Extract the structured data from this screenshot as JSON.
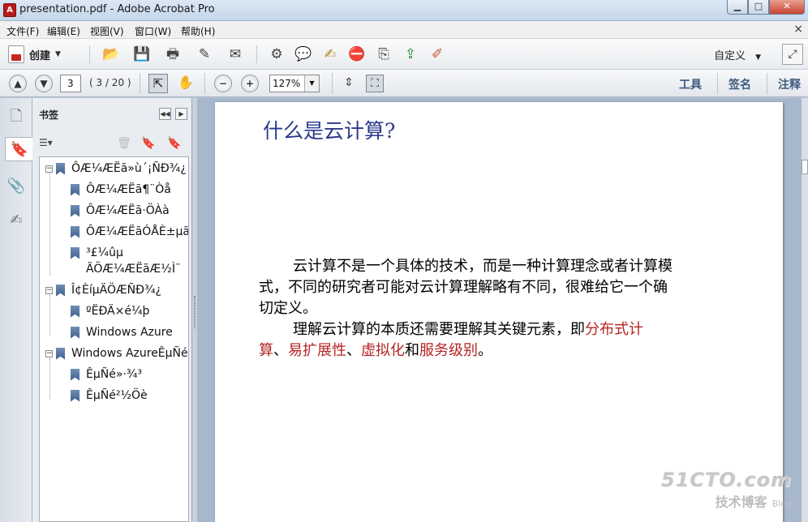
{
  "window": {
    "title": "presentation.pdf - Adobe Acrobat Pro",
    "minimize": "▁",
    "maximize": "□",
    "close": "✕"
  },
  "menu": {
    "items": [
      "文件(F)",
      "编辑(E)",
      "视图(V)",
      "窗口(W)",
      "帮助(H)"
    ],
    "close_doc": "×"
  },
  "toolbar": {
    "create_label": "创建",
    "customize_label": "自定义"
  },
  "navigation": {
    "page_number": "3",
    "page_count": "( 3 / 20 )",
    "zoom": "127%"
  },
  "panels": {
    "tools": "工具",
    "sign": "签名",
    "comment": "注释"
  },
  "bookmarks": {
    "header": "书签",
    "items": [
      {
        "label": "ÔÆ¼ÆËã»ù´¡ÑÐ¾¿",
        "level": 0,
        "toggle": "⊟"
      },
      {
        "label": "ÔÆ¼ÆËã¶¨Òå",
        "level": 1
      },
      {
        "label": "ÔÆ¼ÆËã·ÖÀà",
        "level": 1
      },
      {
        "label": "ÔÆ¼ÆËãÓÅÈ±µã",
        "level": 1
      },
      {
        "label": "³£¼ûµ",
        "level": 1
      },
      {
        "label": "ÄÖÆ¼ÆËãÆ½Ì¨",
        "level": 1,
        "continuation": true
      },
      {
        "label": "Î¢ÈíµÄÖÆÑÐ¾¿",
        "level": 0,
        "toggle": "⊟"
      },
      {
        "label": "ºËÐÄ×é¼þ",
        "level": 1
      },
      {
        "label": "Windows Azure",
        "level": 1
      },
      {
        "label": "Windows AzureÊµÑé",
        "level": 0,
        "toggle": "⊟"
      },
      {
        "label": "ÊµÑé»·¾³",
        "level": 1
      },
      {
        "label": "ÊµÑé²½Öè",
        "level": 1
      }
    ]
  },
  "document": {
    "heading": "什么是云计算?",
    "paragraph1": "云计算不是一个具体的技术，而是一种计算理念或者计算模",
    "paragraph1_line2": "式，不同的研究者可能对云计算理解略有不同，很难给它一个确",
    "paragraph1_line3": "切定义。",
    "paragraph2_start": "理解云计算的本质还需要理解其关键元素，即",
    "term1": "分布式计",
    "term1_cont": "算",
    "sep1": "、",
    "term2": "易扩展性",
    "sep2": "、",
    "term3": "虚拟化",
    "sep3": "和",
    "term4": "服务级别",
    "end": "。",
    "accent_color": "#b42424"
  },
  "watermark": {
    "line1": "51CTO.com",
    "line2": "技术博客",
    "line3": "Blog"
  }
}
